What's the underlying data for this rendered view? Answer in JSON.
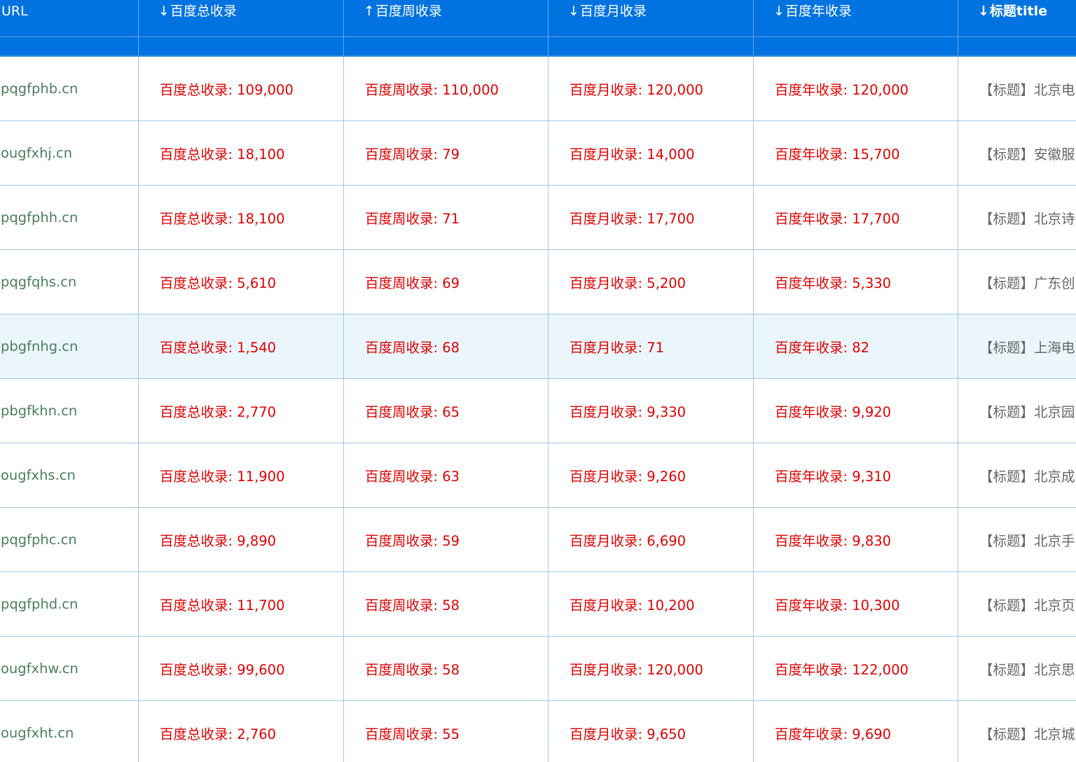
{
  "columns": [
    {
      "label": "URL",
      "arrow": ""
    },
    {
      "label": "百度总收录",
      "arrow": "↓"
    },
    {
      "label": "百度周收录",
      "arrow": "↑"
    },
    {
      "label": "百度月收录",
      "arrow": "↓"
    },
    {
      "label": "百度年收录",
      "arrow": "↓"
    },
    {
      "label": "标题title",
      "arrow": "↓"
    }
  ],
  "prefixes": {
    "total": "百度总收录: ",
    "week": "百度周收录: ",
    "month": "百度月收录: ",
    "year": "百度年收录: ",
    "title": "【标题】"
  },
  "rows": [
    {
      "url": "pqgfphb.cn",
      "total": "百度总收录: 109,000",
      "week": "百度周收录: 110,000",
      "month": "百度月收录: 120,000",
      "year": "百度年收录: 120,000",
      "title": "【标题】北京电"
    },
    {
      "url": "ougfxhj.cn",
      "total": "百度总收录: 18,100",
      "week": "百度周收录: 79",
      "month": "百度月收录: 14,000",
      "year": "百度年收录: 15,700",
      "title": "【标题】安徽服"
    },
    {
      "url": "pqgfphh.cn",
      "total": "百度总收录: 18,100",
      "week": "百度周收录: 71",
      "month": "百度月收录: 17,700",
      "year": "百度年收录: 17,700",
      "title": "【标题】北京诗"
    },
    {
      "url": "pqgfqhs.cn",
      "total": "百度总收录: 5,610",
      "week": "百度周收录: 69",
      "month": "百度月收录: 5,200",
      "year": "百度年收录: 5,330",
      "title": "【标题】广东创"
    },
    {
      "url": "pbgfnhg.cn",
      "total": "百度总收录: 1,540",
      "week": "百度周收录: 68",
      "month": "百度月收录: 71",
      "year": "百度年收录: 82",
      "title": "【标题】上海电",
      "highlight": true
    },
    {
      "url": "pbgfkhn.cn",
      "total": "百度总收录: 2,770",
      "week": "百度周收录: 65",
      "month": "百度月收录: 9,330",
      "year": "百度年收录: 9,920",
      "title": "【标题】北京园"
    },
    {
      "url": "ougfxhs.cn",
      "total": "百度总收录: 11,900",
      "week": "百度周收录: 63",
      "month": "百度月收录: 9,260",
      "year": "百度年收录: 9,310",
      "title": "【标题】北京成"
    },
    {
      "url": "pqgfphc.cn",
      "total": "百度总收录: 9,890",
      "week": "百度周收录: 59",
      "month": "百度月收录: 6,690",
      "year": "百度年收录: 9,830",
      "title": "【标题】北京手"
    },
    {
      "url": "pqgfphd.cn",
      "total": "百度总收录: 11,700",
      "week": "百度周收录: 58",
      "month": "百度月收录: 10,200",
      "year": "百度年收录: 10,300",
      "title": "【标题】北京页"
    },
    {
      "url": "ougfxhw.cn",
      "total": "百度总收录: 99,600",
      "week": "百度周收录: 58",
      "month": "百度月收录: 120,000",
      "year": "百度年收录: 122,000",
      "title": "【标题】北京思"
    },
    {
      "url": "ougfxht.cn",
      "total": "百度总收录: 2,760",
      "week": "百度周收录: 55",
      "month": "百度月收录: 9,650",
      "year": "百度年收录: 9,690",
      "title": "【标题】北京城"
    }
  ],
  "colors": {
    "header_bg": "#0073e0",
    "value_red": "#e00000",
    "url_green": "#4a7d60",
    "title_gray": "#666666",
    "row_highlight": "#ebf6fc",
    "grid_line": "#9fc8e2"
  }
}
